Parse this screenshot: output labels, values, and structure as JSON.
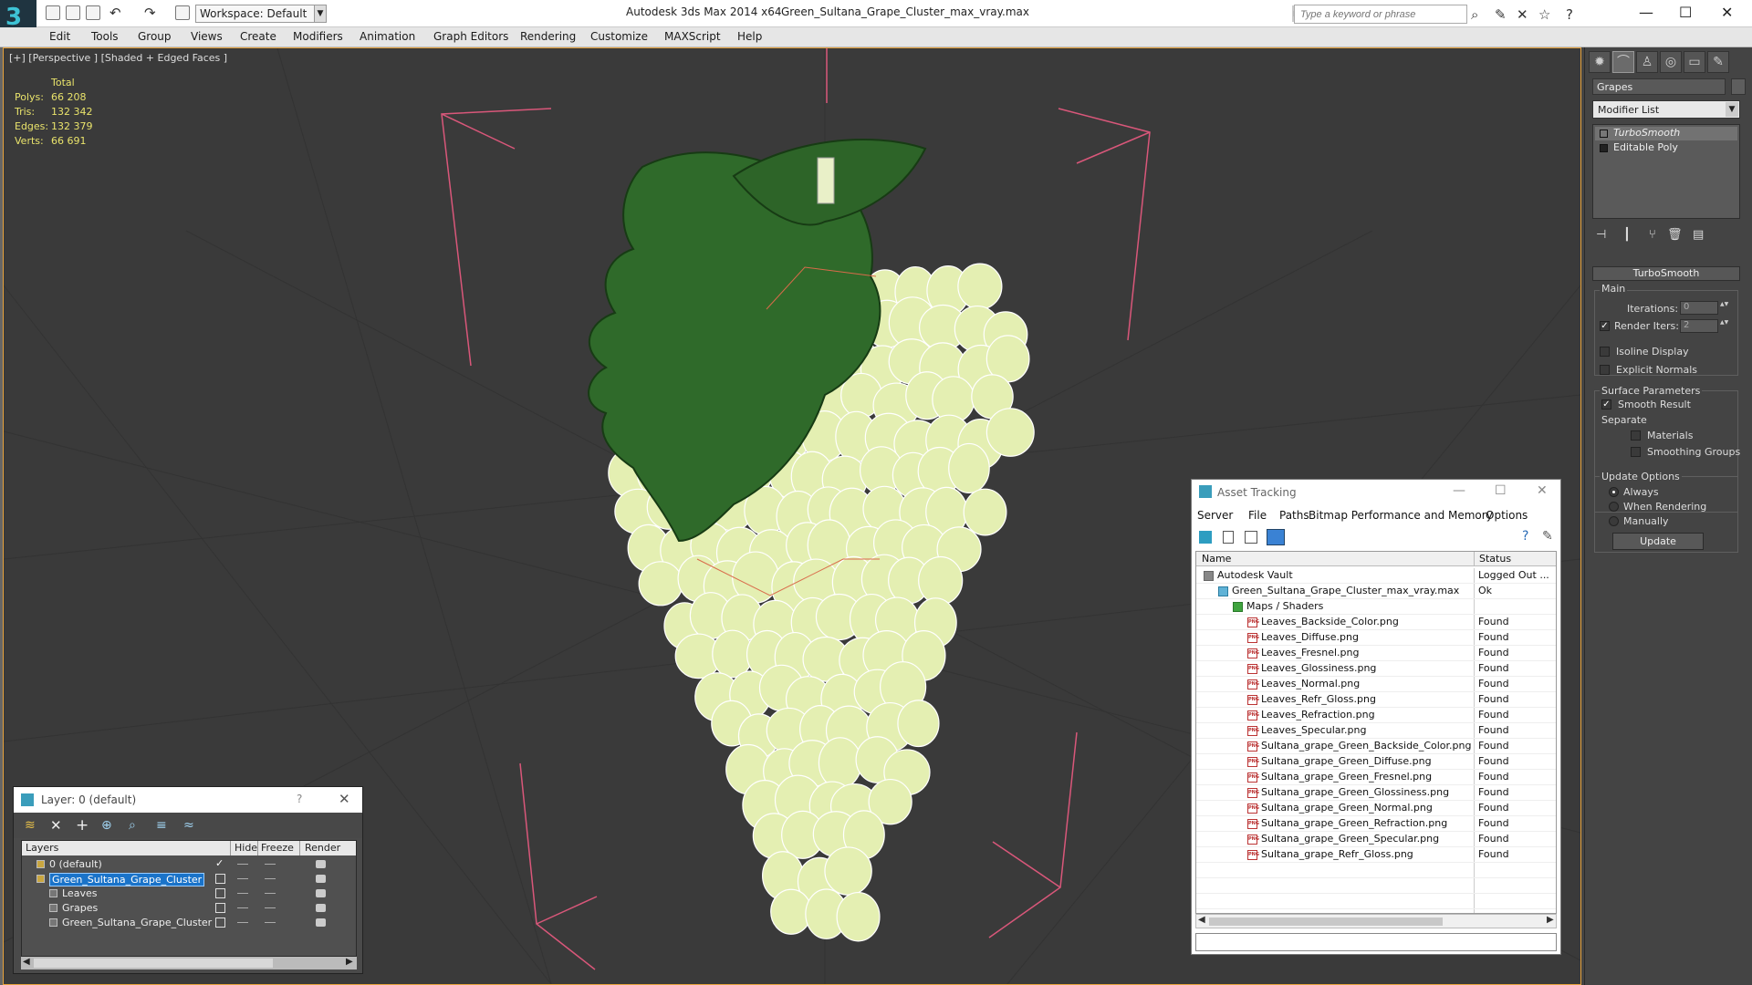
{
  "titlebar": {
    "app_title": "Autodesk 3ds Max  2014 x64",
    "file_title": "Green_Sultana_Grape_Cluster_max_vray.max",
    "workspace": "Workspace: Default",
    "search_placeholder": "Type a keyword or phrase"
  },
  "menu": [
    "Edit",
    "Tools",
    "Group",
    "Views",
    "Create",
    "Modifiers",
    "Animation",
    "Graph Editors",
    "Rendering",
    "Customize",
    "MAXScript",
    "Help"
  ],
  "viewport": {
    "label": "[+] [Perspective ] [Shaded + Edged Faces ]",
    "stats_header": "Total",
    "stats": [
      {
        "label": "Polys:",
        "value": "66 208"
      },
      {
        "label": "Tris:",
        "value": "132 342"
      },
      {
        "label": "Edges:",
        "value": "132 379"
      },
      {
        "label": "Verts:",
        "value": "66 691"
      }
    ]
  },
  "command_panel": {
    "object_name": "Grapes",
    "modifier_list": "Modifier List",
    "stack": [
      "TurboSmooth",
      "Editable Poly"
    ],
    "rollout_title": "TurboSmooth",
    "main_label": "Main",
    "iterations_label": "Iterations:",
    "iterations_value": "0",
    "render_iters_label": "Render Iters:",
    "render_iters_value": "2",
    "isoline_label": "Isoline Display",
    "explicit_normals_label": "Explicit Normals",
    "surface_params_label": "Surface Parameters",
    "smooth_result_label": "Smooth Result",
    "separate_label": "Separate",
    "materials_label": "Materials",
    "smoothing_groups_label": "Smoothing Groups",
    "update_options_label": "Update Options",
    "always_label": "Always",
    "when_rendering_label": "When Rendering",
    "manually_label": "Manually",
    "update_button": "Update"
  },
  "asset_tracking": {
    "title": "Asset Tracking",
    "menu": [
      "Server",
      "File",
      "Paths",
      "Bitmap Performance and Memory",
      "Options"
    ],
    "col_name": "Name",
    "col_status": "Status",
    "rows": [
      {
        "name": "Autodesk Vault",
        "status": "Logged Out ...",
        "indent": 0,
        "icon": "vault"
      },
      {
        "name": "Green_Sultana_Grape_Cluster_max_vray.max",
        "status": "Ok",
        "indent": 1,
        "icon": "max"
      },
      {
        "name": "Maps / Shaders",
        "status": "",
        "indent": 2,
        "icon": "folder"
      },
      {
        "name": "Leaves_Backside_Color.png",
        "status": "Found",
        "indent": 3,
        "icon": "png"
      },
      {
        "name": "Leaves_Diffuse.png",
        "status": "Found",
        "indent": 3,
        "icon": "png"
      },
      {
        "name": "Leaves_Fresnel.png",
        "status": "Found",
        "indent": 3,
        "icon": "png"
      },
      {
        "name": "Leaves_Glossiness.png",
        "status": "Found",
        "indent": 3,
        "icon": "png"
      },
      {
        "name": "Leaves_Normal.png",
        "status": "Found",
        "indent": 3,
        "icon": "png"
      },
      {
        "name": "Leaves_Refr_Gloss.png",
        "status": "Found",
        "indent": 3,
        "icon": "png"
      },
      {
        "name": "Leaves_Refraction.png",
        "status": "Found",
        "indent": 3,
        "icon": "png"
      },
      {
        "name": "Leaves_Specular.png",
        "status": "Found",
        "indent": 3,
        "icon": "png"
      },
      {
        "name": "Sultana_grape_Green_Backside_Color.png",
        "status": "Found",
        "indent": 3,
        "icon": "png"
      },
      {
        "name": "Sultana_grape_Green_Diffuse.png",
        "status": "Found",
        "indent": 3,
        "icon": "png"
      },
      {
        "name": "Sultana_grape_Green_Fresnel.png",
        "status": "Found",
        "indent": 3,
        "icon": "png"
      },
      {
        "name": "Sultana_grape_Green_Glossiness.png",
        "status": "Found",
        "indent": 3,
        "icon": "png"
      },
      {
        "name": "Sultana_grape_Green_Normal.png",
        "status": "Found",
        "indent": 3,
        "icon": "png"
      },
      {
        "name": "Sultana_grape_Green_Refraction.png",
        "status": "Found",
        "indent": 3,
        "icon": "png"
      },
      {
        "name": "Sultana_grape_Green_Specular.png",
        "status": "Found",
        "indent": 3,
        "icon": "png"
      },
      {
        "name": "Sultana_grape_Refr_Gloss.png",
        "status": "Found",
        "indent": 3,
        "icon": "png"
      }
    ]
  },
  "layer_window": {
    "title": "Layer: 0 (default)",
    "help": "?",
    "col_layers": "Layers",
    "col_hide": "Hide",
    "col_freeze": "Freeze",
    "col_render": "Render",
    "rows": [
      {
        "name": "0 (default)",
        "indent": 0,
        "selected": false,
        "checked": true
      },
      {
        "name": "Green_Sultana_Grape_Cluster",
        "indent": 0,
        "selected": true,
        "checked": false
      },
      {
        "name": "Leaves",
        "indent": 1,
        "selected": false,
        "checked": false
      },
      {
        "name": "Grapes",
        "indent": 1,
        "selected": false,
        "checked": false
      },
      {
        "name": "Green_Sultana_Grape_Cluster",
        "indent": 1,
        "selected": false,
        "checked": false
      }
    ]
  },
  "colors": {
    "viewport_bg": "#3a3a3a",
    "stats_text": "#e9e36b",
    "grape": "#e4efb2",
    "leaf": "#2f6a2a",
    "bbox": "#d9577a",
    "active_border": "#e8a33c"
  }
}
